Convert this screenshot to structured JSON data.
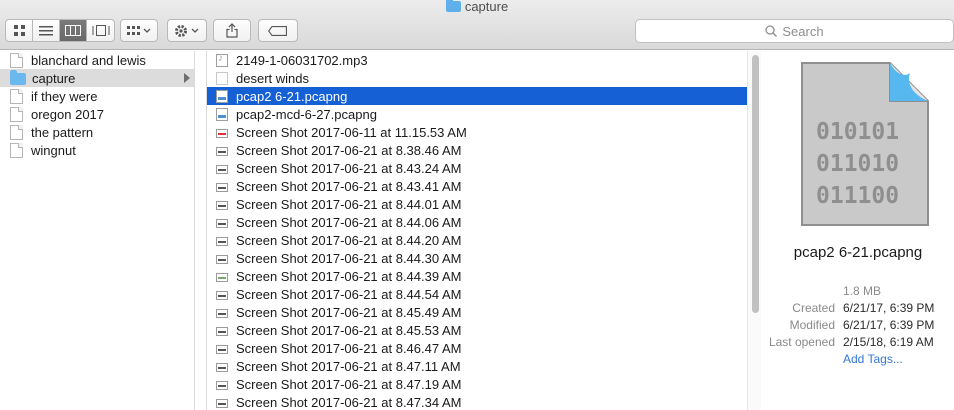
{
  "window": {
    "title": "capture"
  },
  "toolbar": {
    "view_buttons": [
      "icon-view-icon",
      "list-view-icon",
      "column-view-icon",
      "gallery-view-icon"
    ],
    "active_view": 2,
    "search_placeholder": "Search"
  },
  "sidebar_column": {
    "items": [
      {
        "label": "blanchard and lewis",
        "type": "document",
        "selected": false
      },
      {
        "label": "capture",
        "type": "folder",
        "selected": true
      },
      {
        "label": "if they were",
        "type": "document",
        "selected": false
      },
      {
        "label": "oregon 2017",
        "type": "document",
        "selected": false
      },
      {
        "label": "the pattern",
        "type": "document",
        "selected": false
      },
      {
        "label": "wingnut",
        "type": "document",
        "selected": false
      }
    ]
  },
  "files": [
    {
      "label": "2149-1-06031702.mp3",
      "kind": "audio"
    },
    {
      "label": "desert winds",
      "kind": "blank"
    },
    {
      "label": "pcap2 6-21.pcapng",
      "kind": "pcap",
      "selected": true
    },
    {
      "label": "pcap2-mcd-6-27.pcapng",
      "kind": "pcap"
    },
    {
      "label": "Screen Shot 2017-06-11 at 11.15.53 AM",
      "kind": "shot-red"
    },
    {
      "label": "Screen Shot 2017-06-21 at 8.38.46 AM",
      "kind": "shot"
    },
    {
      "label": "Screen Shot 2017-06-21 at 8.43.24 AM",
      "kind": "shot"
    },
    {
      "label": "Screen Shot 2017-06-21 at 8.43.41 AM",
      "kind": "shot"
    },
    {
      "label": "Screen Shot 2017-06-21 at 8.44.01 AM",
      "kind": "shot"
    },
    {
      "label": "Screen Shot 2017-06-21 at 8.44.06 AM",
      "kind": "shot"
    },
    {
      "label": "Screen Shot 2017-06-21 at 8.44.20 AM",
      "kind": "shot"
    },
    {
      "label": "Screen Shot 2017-06-21 at 8.44.30 AM",
      "kind": "shot"
    },
    {
      "label": "Screen Shot 2017-06-21 at 8.44.39 AM",
      "kind": "shot-green"
    },
    {
      "label": "Screen Shot 2017-06-21 at 8.44.54 AM",
      "kind": "shot"
    },
    {
      "label": "Screen Shot 2017-06-21 at 8.45.49 AM",
      "kind": "shot"
    },
    {
      "label": "Screen Shot 2017-06-21 at 8.45.53 AM",
      "kind": "shot"
    },
    {
      "label": "Screen Shot 2017-06-21 at 8.46.47 AM",
      "kind": "shot"
    },
    {
      "label": "Screen Shot 2017-06-21 at 8.47.11 AM",
      "kind": "shot"
    },
    {
      "label": "Screen Shot 2017-06-21 at 8.47.19 AM",
      "kind": "shot"
    },
    {
      "label": "Screen Shot 2017-06-21 at 8.47.34 AM",
      "kind": "shot"
    }
  ],
  "preview": {
    "icon_text": [
      "010101",
      "011010",
      "011100"
    ],
    "filename": "pcap2 6-21.pcapng",
    "size": "1.8 MB",
    "created_label": "Created",
    "created_value": "6/21/17, 6:39 PM",
    "modified_label": "Modified",
    "modified_value": "6/21/17, 6:39 PM",
    "last_opened_label": "Last opened",
    "last_opened_value": "2/15/18, 6:19 AM",
    "add_tags": "Add Tags..."
  },
  "colors": {
    "selection": "#1660d6",
    "folder": "#6bb8ef",
    "link": "#3478d8"
  }
}
